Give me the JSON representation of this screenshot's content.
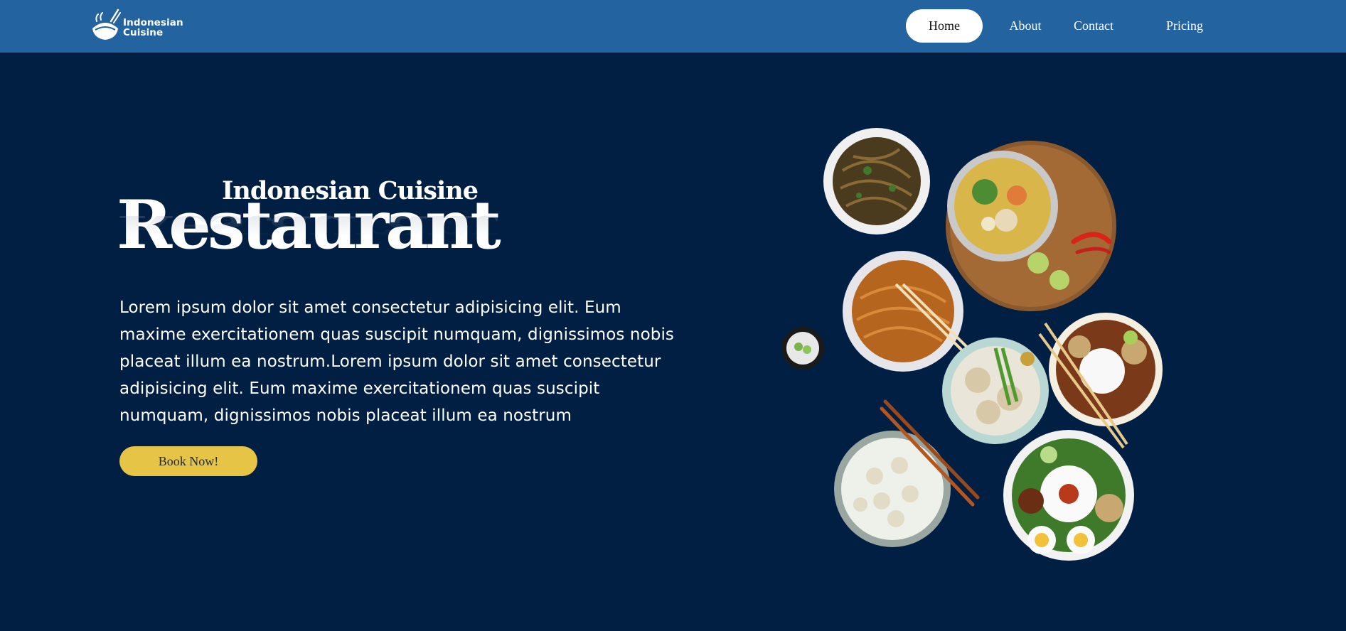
{
  "brand": {
    "logo_line1": "Indonesian",
    "logo_line2": "Cuisine",
    "logo_icon": "bowl-icon"
  },
  "nav": {
    "items": [
      {
        "label": "Home",
        "active": true
      },
      {
        "label": "About",
        "active": false
      },
      {
        "label": "Contact",
        "active": false
      },
      {
        "label": "Pricing",
        "active": false
      }
    ]
  },
  "hero": {
    "subtitle": "Indonesian Cuisine",
    "title": "Restaurant",
    "description": "Lorem ipsum dolor sit amet consectetur adipisicing elit. Eum maxime exercitationem quas suscipit numquam, dignissimos nobis placeat illum ea nostrum.Lorem ipsum dolor sit amet consectetur adipisicing elit. Eum maxime exercitationem quas suscipit numquam, dignissimos nobis placeat illum ea nostrum",
    "cta_label": "Book Now!"
  },
  "colors": {
    "background": "#001f42",
    "navbar": "#2364a0",
    "cta": "#e5c446",
    "text": "#ffffff"
  }
}
